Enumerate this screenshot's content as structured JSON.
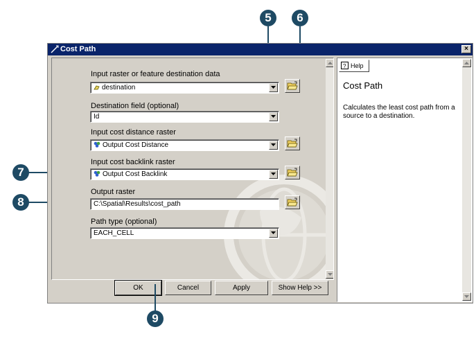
{
  "window": {
    "title": "Cost Path",
    "close_label": "×"
  },
  "form": {
    "input_raster_label": "Input raster or feature destination data",
    "input_raster_value": "destination",
    "destination_field_label": "Destination field (optional)",
    "destination_field_value": "Id",
    "cost_distance_label": "Input cost distance raster",
    "cost_distance_value": "Output Cost Distance",
    "backlink_label": "Input cost backlink raster",
    "backlink_value": "Output Cost Backlink",
    "output_raster_label": "Output raster",
    "output_raster_value": "C:\\Spatial\\Results\\cost_path",
    "path_type_label": "Path type (optional)",
    "path_type_value": "EACH_CELL"
  },
  "buttons": {
    "ok": "OK",
    "cancel": "Cancel",
    "apply": "Apply",
    "show_help": "Show Help >>"
  },
  "help": {
    "tab_label": "Help",
    "title": "Cost Path",
    "body": "Calculates the least cost path from a source to a destination."
  },
  "callouts": [
    "5",
    "6",
    "7",
    "8",
    "9"
  ],
  "colors": {
    "titlebar": "#0a246a",
    "callout": "#1e4a64",
    "dialog_face": "#d4d0c8"
  }
}
